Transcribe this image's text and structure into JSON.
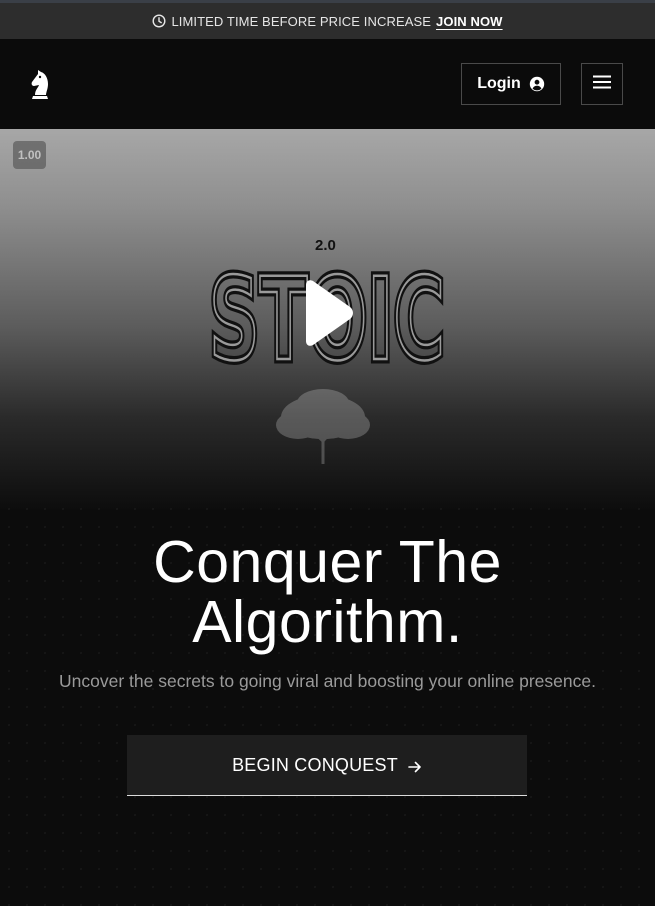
{
  "promo": {
    "text": "LIMITED TIME BEFORE PRICE INCREASE",
    "link_label": "JOIN NOW",
    "icon": "clock-icon"
  },
  "header": {
    "logo_icon": "chess-knight-icon",
    "login_label": "Login",
    "login_icon": "user-circle-icon",
    "menu_icon": "hamburger-menu-icon"
  },
  "video": {
    "speed": "1.00",
    "title_version": "2.0",
    "title_word": "STOIC",
    "play_icon": "play-icon"
  },
  "hero": {
    "title_line1": "Conquer The",
    "title_line2": "Algorithm.",
    "subtitle": "Uncover the secrets to going viral and boosting your online presence.",
    "cta_label": "BEGIN CONQUEST",
    "cta_icon": "arrow-right-icon"
  },
  "colors": {
    "background": "#0c0c0c",
    "promo_bar": "#2d2d2d",
    "text_primary": "#ffffff",
    "text_muted": "#9a9a9a",
    "cta_background": "#1e1e1e"
  }
}
